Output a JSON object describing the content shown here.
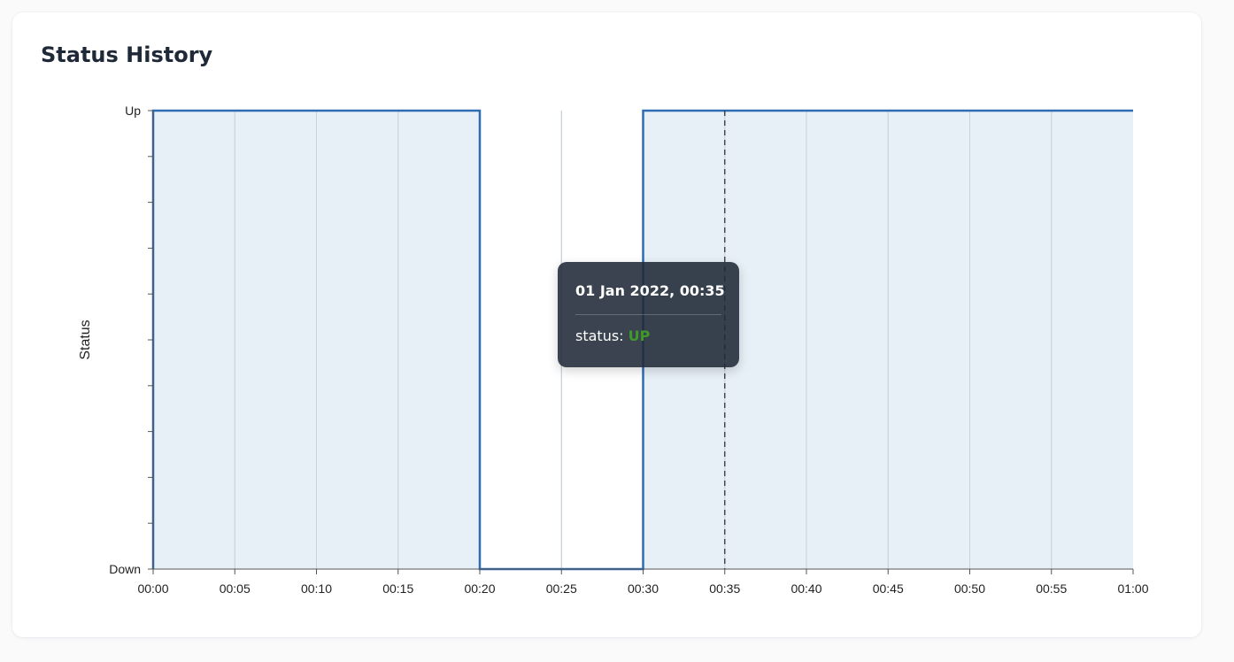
{
  "card": {
    "title": "Status History"
  },
  "tooltip": {
    "title": "01 Jan 2022, 00:35",
    "label": "status",
    "value": "UP",
    "value_color": "#3f9a2a"
  },
  "chart_data": {
    "type": "area",
    "step": true,
    "title": "",
    "xlabel": "",
    "ylabel": "Status",
    "x_ticks": [
      "00:00",
      "00:05",
      "00:10",
      "00:15",
      "00:20",
      "00:25",
      "00:30",
      "00:35",
      "00:40",
      "00:45",
      "00:50",
      "00:55",
      "01:00"
    ],
    "y_ticks": [
      "Down",
      "Up"
    ],
    "xlim": [
      "00:00",
      "01:00"
    ],
    "ylim": [
      0,
      1
    ],
    "series": [
      {
        "points": [
          {
            "x": "00:00",
            "y": 1
          },
          {
            "x": "00:20",
            "y": 1
          },
          {
            "x": "00:20",
            "y": 0
          },
          {
            "x": "00:30",
            "y": 0
          },
          {
            "x": "00:30",
            "y": 1
          },
          {
            "x": "01:00",
            "y": 1
          }
        ]
      }
    ],
    "hover_x": "00:35",
    "grid": true,
    "colors": {
      "line": "#2f6db3",
      "fill": "#d4e2f1",
      "grid": "#c4cdd8",
      "axis": "#555555"
    }
  }
}
